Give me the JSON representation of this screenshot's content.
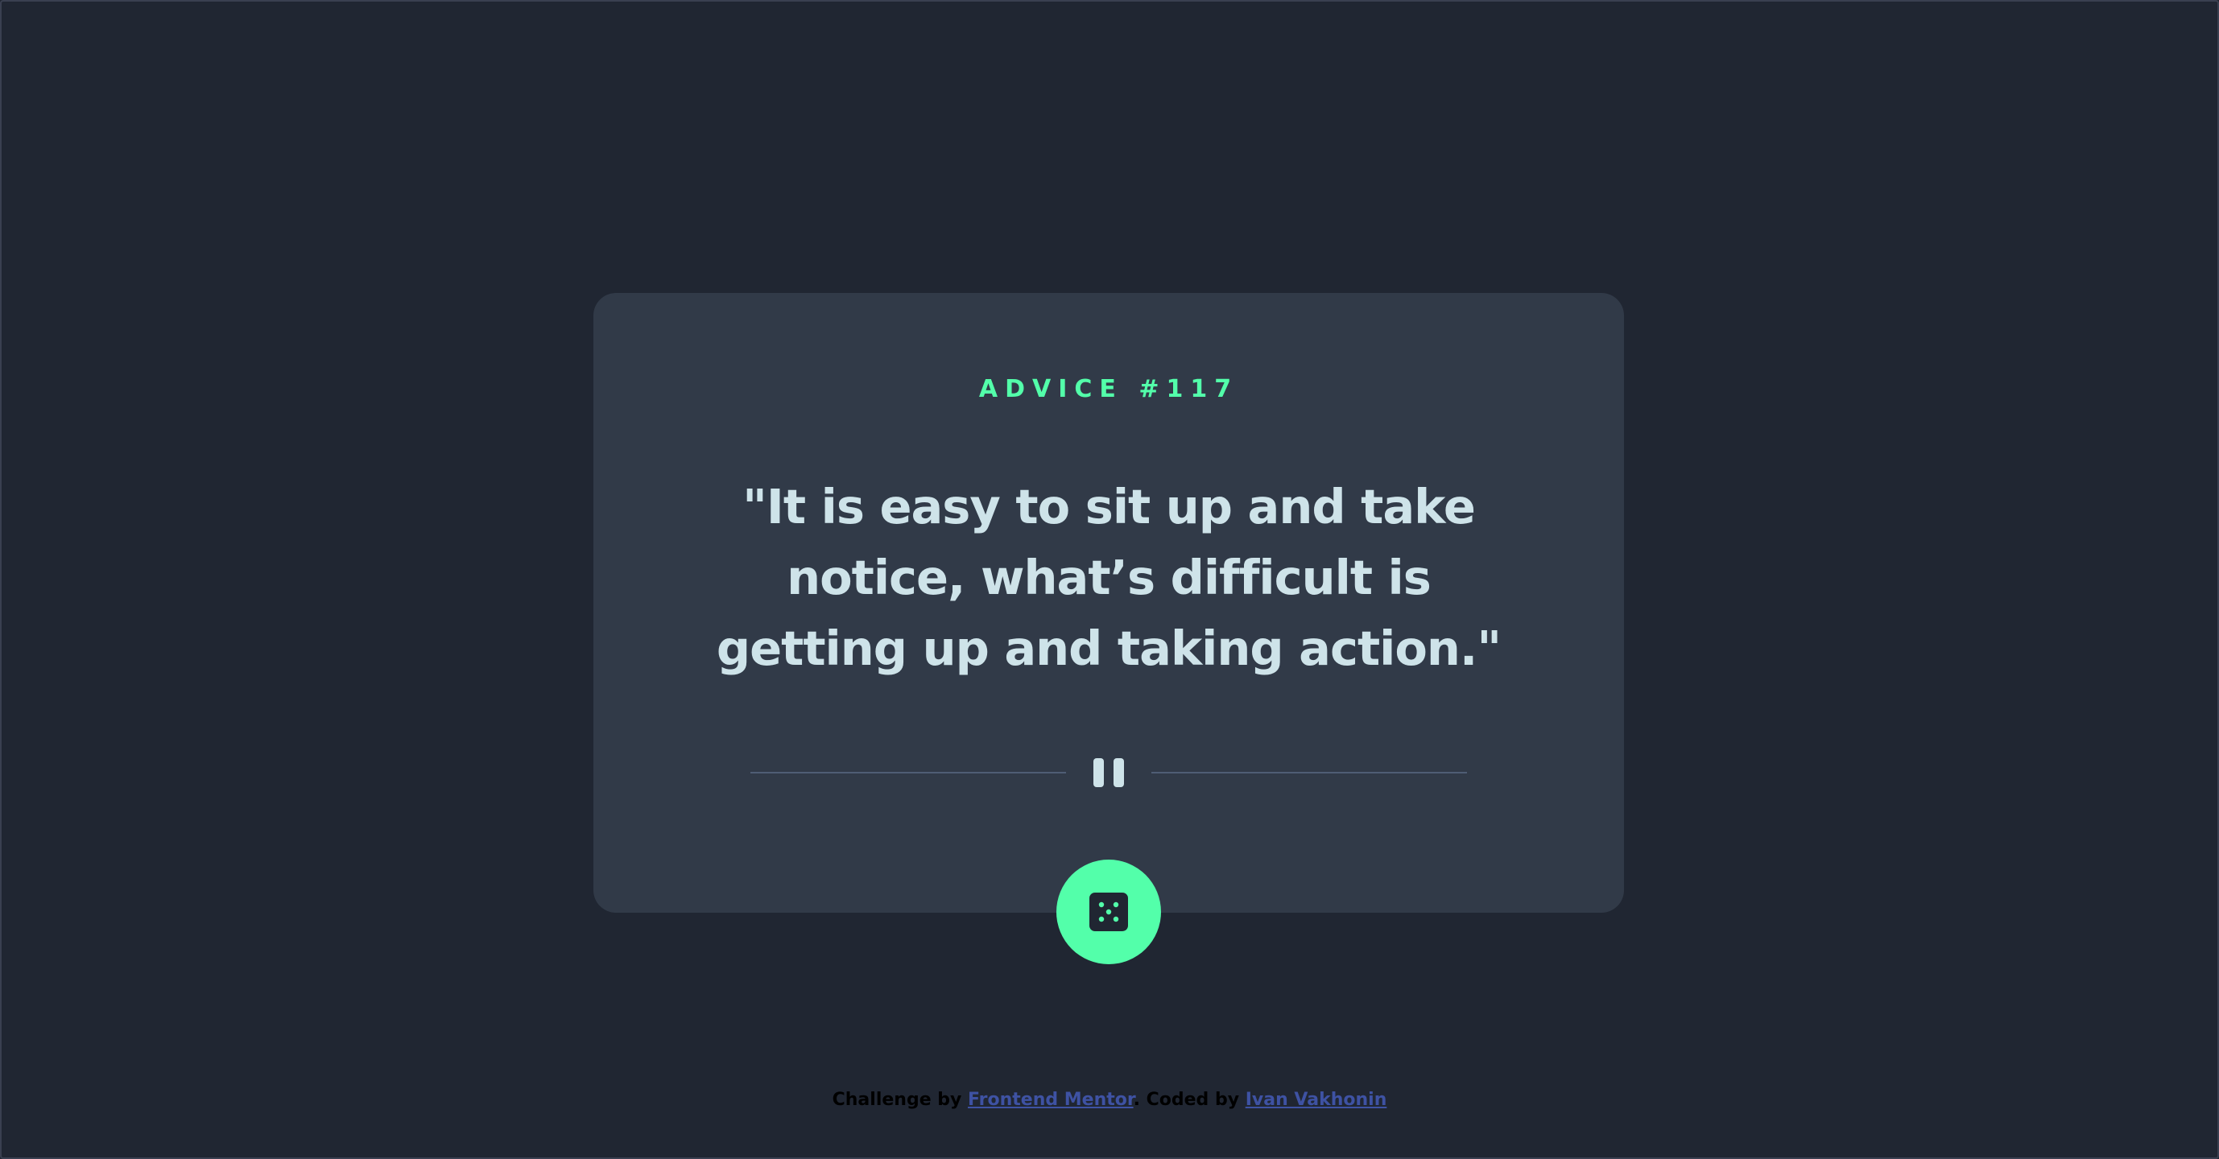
{
  "advice": {
    "id_label": "ADVICE #117",
    "quote": "\"It is easy to sit up and take notice, what’s difficult is getting up and taking action.\""
  },
  "controls": {
    "divider_icon": "pause-icon",
    "dice_icon": "dice-icon"
  },
  "footer": {
    "prefix": "Challenge by ",
    "link1": "Frontend Mentor",
    "middle": ". Coded by ",
    "link2": "Ivan Vakhonin"
  },
  "colors": {
    "background": "#202632",
    "card": "#313a48",
    "accent": "#53ffaa",
    "quote_text": "#cee3e9",
    "divider": "#4f5d74",
    "link": "#3e52a3"
  }
}
